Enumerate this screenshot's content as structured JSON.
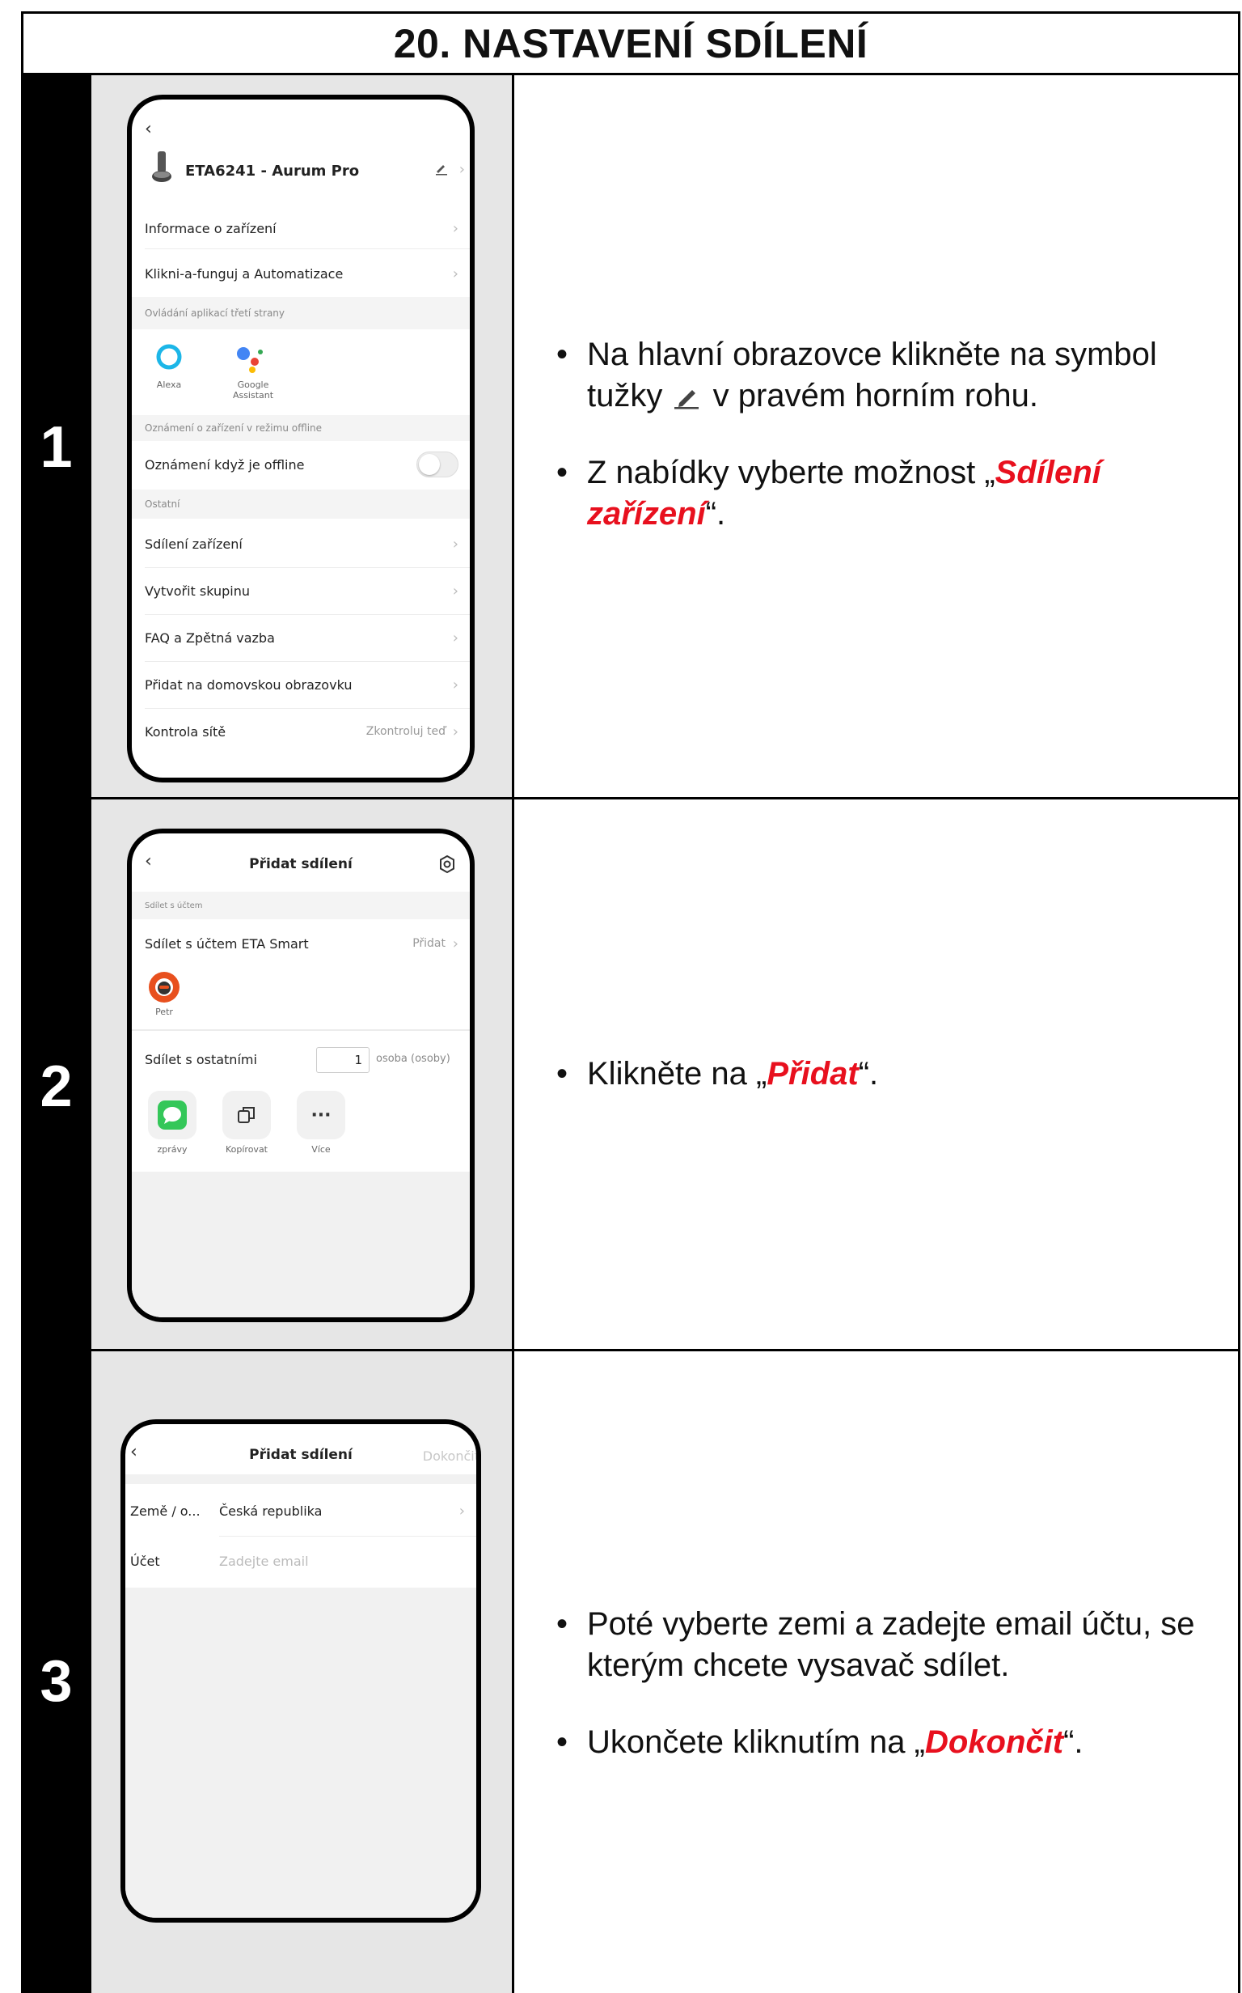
{
  "title": "20. NASTAVENÍ SDÍLENÍ",
  "steps": [
    {
      "number": "1",
      "bullets": [
        {
          "parts": [
            "Na hlavní obrazovce klikněte na symbol tužky ",
            "pencil",
            " v pravém horním rohu."
          ]
        },
        {
          "prefix": "Z nabídky vyberte možnost „",
          "highlight": "Sdílení zařízení",
          "suffix": "“."
        }
      ],
      "phone": {
        "device_name": "ETA6241 - Aurum Pro",
        "items": [
          "Informace o zařízení",
          "Klikni-a-funguj a Automatizace"
        ],
        "section_third_party": "Ovládání aplikací třetí strany",
        "alexa_label": "Alexa",
        "google_label": "Google Assistant",
        "section_offline": "Oznámení o zařízení v režimu offline",
        "offline_toggle_label": "Oznámení když je offline",
        "section_other": "Ostatní",
        "other_items": [
          "Sdílení zařízení",
          "Vytvořit skupinu",
          "FAQ a Zpětná vazba",
          "Přidat na domovskou obrazovku"
        ],
        "network_label": "Kontrola sítě",
        "network_action": "Zkontroluj teď"
      }
    },
    {
      "number": "2",
      "bullets": [
        {
          "prefix": "Klikněte na „",
          "highlight": "Přidat",
          "suffix": "“."
        }
      ],
      "phone": {
        "title": "Přidat sdílení",
        "section": "Sdílet s účtem",
        "share_account_label": "Sdílet s účtem ETA Smart",
        "share_account_action": "Přidat",
        "user_name": "Petr",
        "share_others_label": "Sdílet s ostatními",
        "count_value": "1",
        "count_unit": "osoba (osoby)",
        "apps": [
          "zprávy",
          "Kopírovat",
          "Více"
        ]
      }
    },
    {
      "number": "3",
      "bullets": [
        {
          "text": "Poté vyberte zemi a zadejte email účtu, se kterým chcete vysavač sdílet."
        },
        {
          "prefix": "Ukončete kliknutím na „",
          "highlight": "Dokončit",
          "suffix": "“."
        }
      ],
      "phone": {
        "title": "Přidat sdílení",
        "done_action": "Dokončit",
        "country_label": "Země / o...",
        "country_value": "Česká republika",
        "account_label": "Účet",
        "email_placeholder": "Zadejte email"
      }
    }
  ],
  "colors": {
    "highlight": "#e8101e",
    "shot_bg": "#e6e6e6",
    "google_blue": "#4285F4",
    "google_red": "#EA4335",
    "google_yellow": "#FBBC05",
    "google_green": "#34A853",
    "alexa_cyan": "#1cb6e8",
    "messages_green": "#34c759"
  }
}
